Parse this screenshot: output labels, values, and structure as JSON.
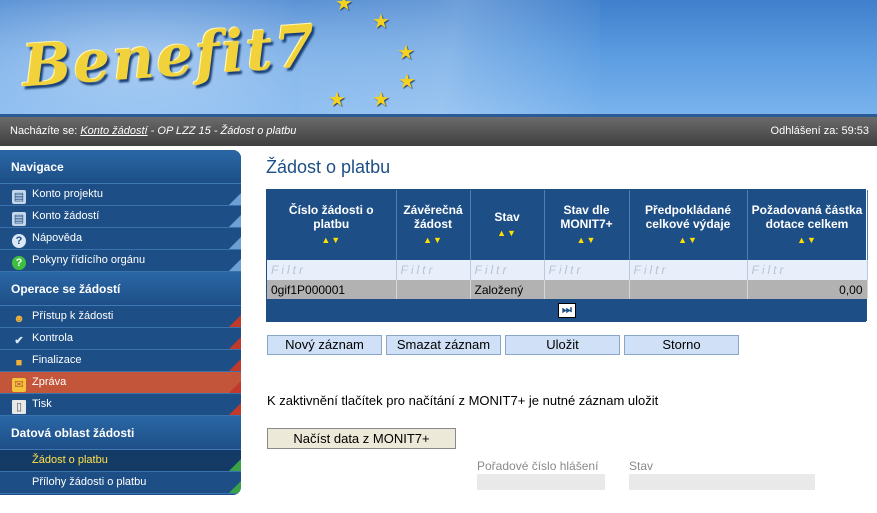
{
  "banner": {
    "logo_text": "Benefit7"
  },
  "status": {
    "prefix": "Nacházíte se:",
    "link": "Konto žádostí",
    "rest": " - OP LZZ 15 - Žádost o platbu",
    "logout_label": "Odhlášení za:",
    "logout_time": "59:53"
  },
  "sidebar": {
    "sections": [
      {
        "title": "Navigace",
        "items": [
          {
            "label": "Konto projektu",
            "icon": "project-icon"
          },
          {
            "label": "Konto žádostí",
            "icon": "requests-icon"
          },
          {
            "label": "Nápověda",
            "icon": "help-icon"
          },
          {
            "label": "Pokyny řídícího orgánu",
            "icon": "guidelines-icon"
          }
        ]
      },
      {
        "title": "Operace se žádostí",
        "items": [
          {
            "label": "Přístup k žádosti",
            "icon": "access-icon"
          },
          {
            "label": "Kontrola",
            "icon": "check-icon"
          },
          {
            "label": "Finalizace",
            "icon": "lock-icon"
          },
          {
            "label": "Zpráva",
            "icon": "message-icon"
          },
          {
            "label": "Tisk",
            "icon": "print-icon"
          }
        ]
      },
      {
        "title": "Datová oblast žádosti",
        "items": [
          {
            "label": "Žádost o platbu",
            "icon": ""
          },
          {
            "label": "Přílohy žádosti o platbu",
            "icon": ""
          }
        ]
      }
    ]
  },
  "main": {
    "title": "Žádost o platbu",
    "table": {
      "columns": [
        "Číslo žádosti o platbu",
        "Závěrečná žádost",
        "Stav",
        "Stav dle MONIT7+",
        "Předpokládané celkové výdaje",
        "Požadovaná částka dotace celkem"
      ],
      "filter_placeholder": "Filtr",
      "rows": [
        [
          "0gif1P000001",
          "",
          "Založený",
          "",
          "",
          "0,00"
        ]
      ]
    },
    "buttons": {
      "new": "Nový záznam",
      "delete": "Smazat záznam",
      "save": "Uložit",
      "cancel": "Storno"
    },
    "note": "K zaktivnění tlačítek pro načítání z MONIT7+ je nutné záznam uložit",
    "load_button": "Načíst data z MONIT7+",
    "fields": {
      "order_label": "Pořadové číslo hlášení",
      "state_label": "Stav"
    }
  }
}
